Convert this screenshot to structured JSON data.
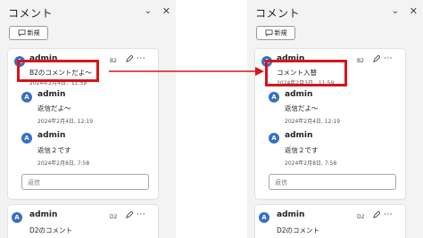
{
  "colors": {
    "highlight": "#d81418",
    "avatar": "#3470c6",
    "pane_bg": "#f3f3f3"
  },
  "panels": {
    "left": {
      "title": "コメント",
      "new_button": "新規",
      "thread": {
        "author": "admin",
        "avatar": "A",
        "slide_tag": "B2",
        "text": "B2のコメントだよ～",
        "date": "2024年2月4日、11:59",
        "replies": [
          {
            "author": "admin",
            "avatar": "A",
            "text": "返信だよ～",
            "date": "2024年2月4日, 12:19"
          },
          {
            "author": "admin",
            "avatar": "A",
            "text": "返信２です",
            "date": "2024年2月8日, 7:58"
          }
        ],
        "reply_placeholder": "返信"
      },
      "next_thread": {
        "author": "admin",
        "avatar": "A",
        "slide_tag": "D2",
        "text": "D2のコメント"
      }
    },
    "right": {
      "title": "コメント",
      "new_button": "新規",
      "thread": {
        "author": "admin",
        "avatar": "A",
        "slide_tag": "B2",
        "text": "コメント入替",
        "date": "2024年2月3日、11:59",
        "replies": [
          {
            "author": "admin",
            "avatar": "A",
            "text": "返信だよ～",
            "date": "2024年2月4日, 12:19"
          },
          {
            "author": "admin",
            "avatar": "A",
            "text": "返信２です",
            "date": "2024年2月8日, 7:58"
          }
        ],
        "reply_placeholder": "返信"
      },
      "next_thread": {
        "author": "admin",
        "avatar": "A",
        "slide_tag": "D2",
        "text": "D2のコメント"
      }
    }
  }
}
